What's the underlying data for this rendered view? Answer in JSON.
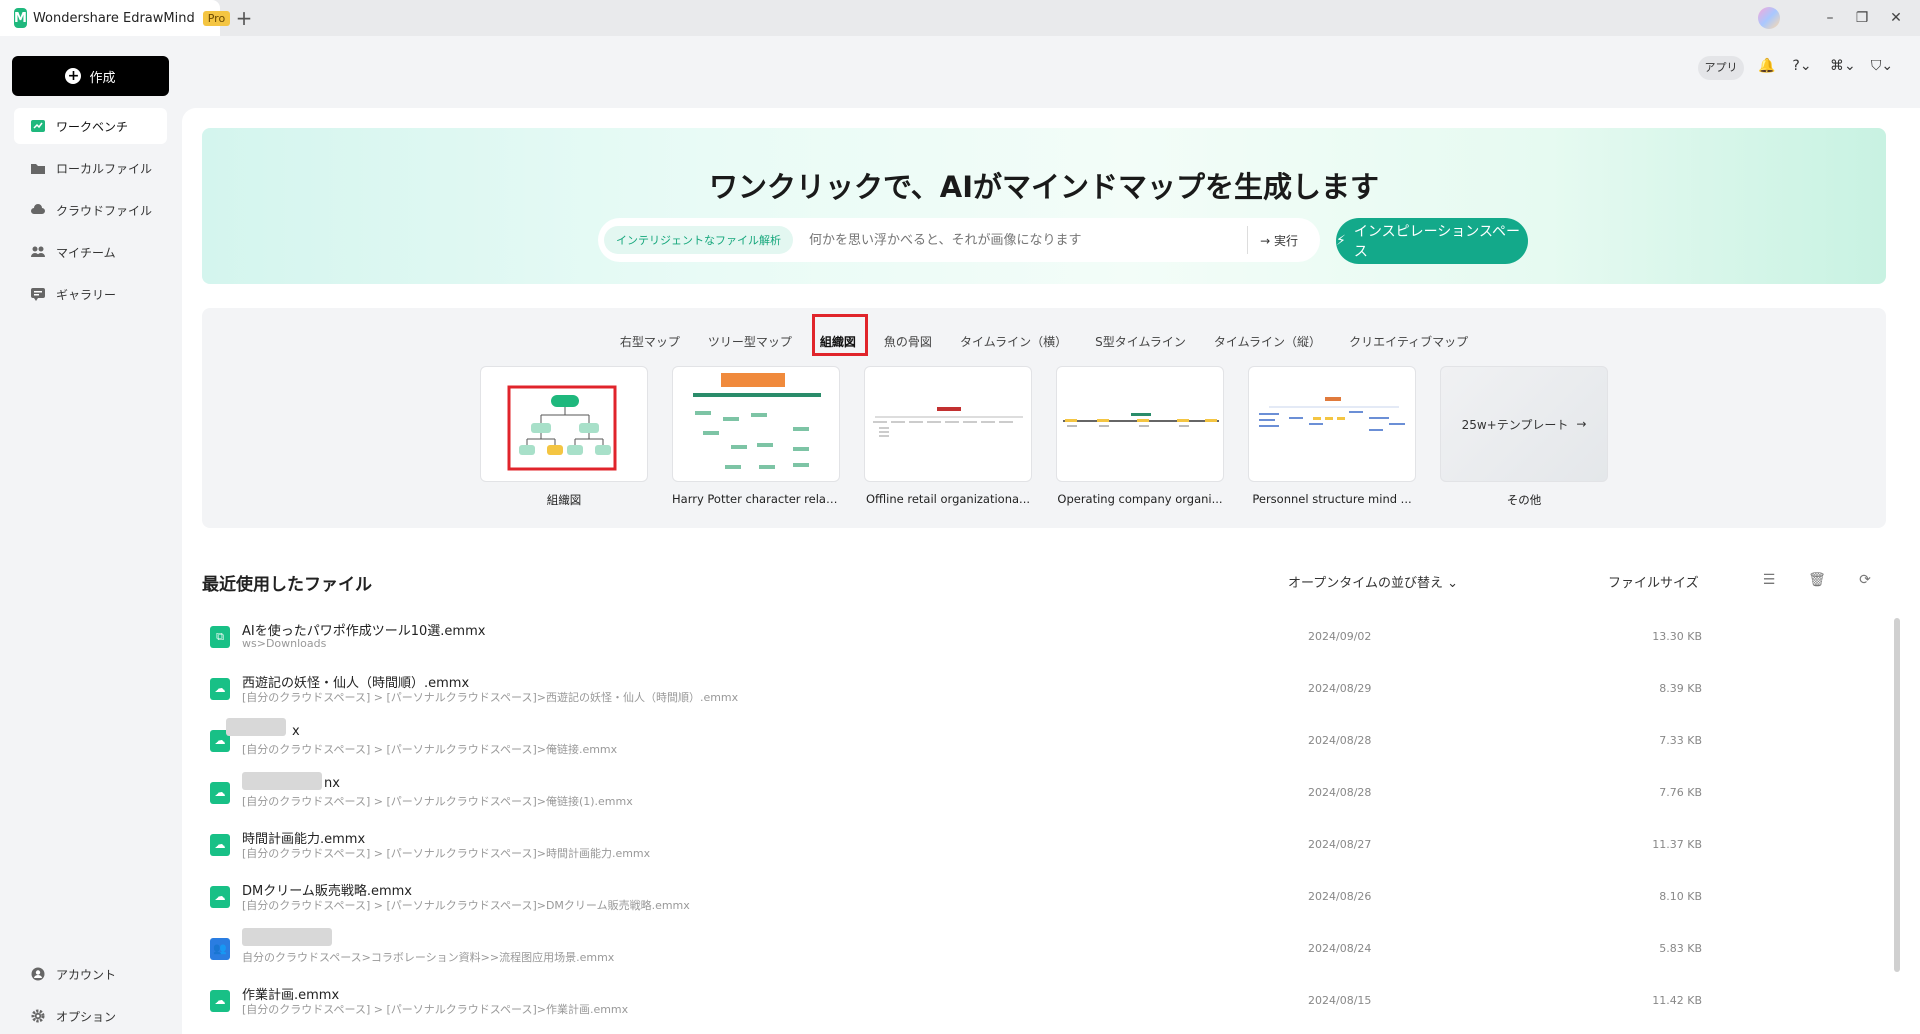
{
  "app": {
    "title": "Wondershare EdrawMind",
    "badge": "Pro",
    "new_tab": "+"
  },
  "window": {
    "minimize": "–",
    "restore": "❐",
    "close": "✕"
  },
  "sidebar": {
    "create_label": "作成",
    "items": [
      {
        "label": "ワークベンチ",
        "icon": "workbench-icon"
      },
      {
        "label": "ローカルファイル",
        "icon": "folder-icon"
      },
      {
        "label": "クラウドファイル",
        "icon": "cloud-icon"
      },
      {
        "label": "マイチーム",
        "icon": "team-icon"
      },
      {
        "label": "ギャラリー",
        "icon": "gallery-icon"
      }
    ],
    "bottom": [
      {
        "label": "アカウント",
        "icon": "account-icon"
      },
      {
        "label": "オプション",
        "icon": "gear-icon"
      }
    ]
  },
  "toolbar": {
    "apps_label": "アプリ"
  },
  "hero": {
    "title": "ワンクリックで、AIがマインドマップを生成します",
    "chip": "インテリジェントなファイル解析",
    "placeholder": "何かを思い浮かべると、それが画像になります",
    "exec_label": "実行",
    "inspire_label": "インスピレーションスペース"
  },
  "templates": {
    "tabs": [
      "右型マップ",
      "ツリー型マップ",
      "組織図",
      "魚の骨図",
      "タイムライン（横）",
      "S型タイムライン",
      "タイムライン（縦）",
      "クリエイティブマップ"
    ],
    "active_tab": 2,
    "cards": [
      {
        "label": "組織図"
      },
      {
        "label": "Harry Potter character relat..."
      },
      {
        "label": "Offline retail organizationa..."
      },
      {
        "label": "Operating company organi..."
      },
      {
        "label": "Personnel structure mind ..."
      },
      {
        "label": "その他",
        "overlay": "25w+テンプレート"
      }
    ]
  },
  "recent": {
    "title": "最近使用したファイル",
    "sort_label": "オープンタイムの並び替え",
    "size_header": "ファイルサイズ",
    "files": [
      {
        "name": "AIを使ったパワポ作成ツール10選.emmx",
        "path": "ws>Downloads",
        "date": "2024/09/02",
        "size": "13.30 KB",
        "icon": "local"
      },
      {
        "name": "西遊記の妖怪・仙人（時間順）.emmx",
        "path": "[自分のクラウドスペース] > [パーソナルクラウドスペース]>西遊記の妖怪・仙人（時間順）.emmx",
        "date": "2024/08/29",
        "size": "8.39 KB",
        "icon": "cloud"
      },
      {
        "name": "x",
        "path": "[自分のクラウドスペース] > [パーソナルクラウドスペース]>俺链接.emmx",
        "date": "2024/08/28",
        "size": "7.33 KB",
        "icon": "cloud",
        "blurred": true
      },
      {
        "name": "nx",
        "path": "[自分のクラウドスペース] > [パーソナルクラウドスペース]>俺链接(1).emmx",
        "date": "2024/08/28",
        "size": "7.76 KB",
        "icon": "cloud",
        "blurred": true
      },
      {
        "name": "時間計画能力.emmx",
        "path": "[自分のクラウドスペース] > [パーソナルクラウドスペース]>時間計画能力.emmx",
        "date": "2024/08/27",
        "size": "11.37 KB",
        "icon": "cloud"
      },
      {
        "name": "DMクリーム販売戦略.emmx",
        "path": "[自分のクラウドスペース] > [パーソナルクラウドスペース]>DMクリーム販売戦略.emmx",
        "date": "2024/08/26",
        "size": "8.10 KB",
        "icon": "cloud"
      },
      {
        "name": "",
        "path": "自分のクラウドスペース>コラボレーション資料>>流程图应用场景.emmx",
        "date": "2024/08/24",
        "size": "5.83 KB",
        "icon": "team",
        "blurred": true
      },
      {
        "name": "作業計画.emmx",
        "path": "[自分のクラウドスペース] > [パーソナルクラウドスペース]>作業計画.emmx",
        "date": "2024/08/15",
        "size": "11.42 KB",
        "icon": "cloud"
      }
    ]
  }
}
